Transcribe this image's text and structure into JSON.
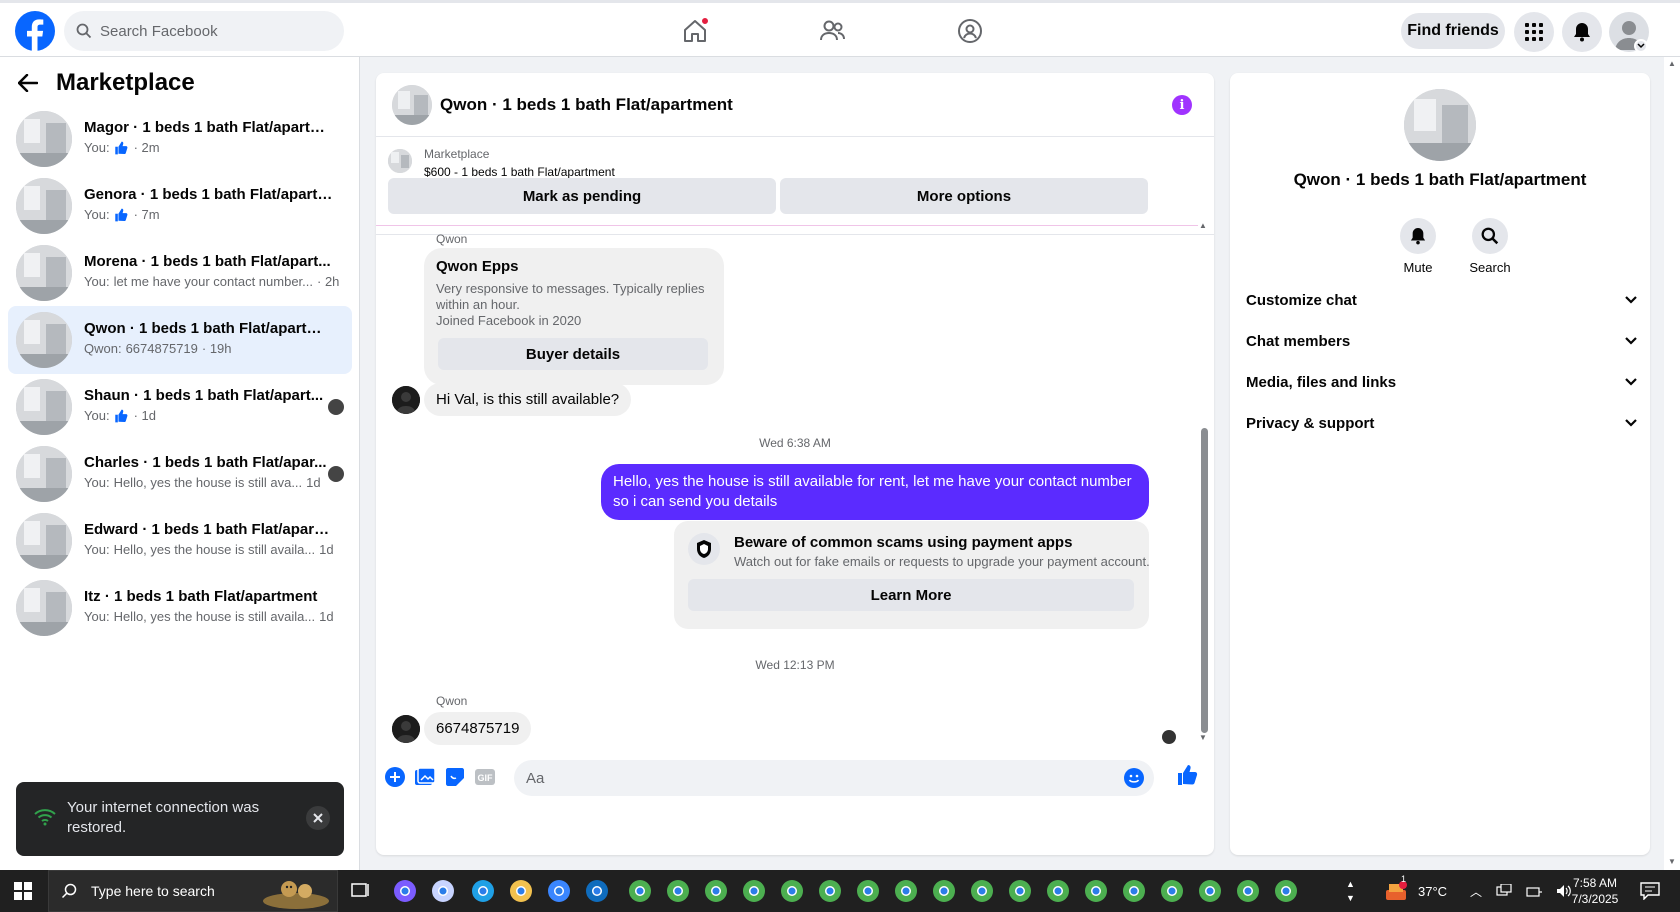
{
  "topbar": {
    "search_placeholder": "Search Facebook",
    "find_friends": "Find friends"
  },
  "sidebar": {
    "title": "Marketplace",
    "conversations": [
      {
        "name": "Magor · 1 beds 1 bath Flat/apartm...",
        "prefix": "You:",
        "snippet": "",
        "time": "· 2m",
        "like": true
      },
      {
        "name": "Genora · 1 beds 1 bath Flat/apartm...",
        "prefix": "You:",
        "snippet": "",
        "time": "· 7m",
        "like": true
      },
      {
        "name": "Morena · 1 beds 1 bath Flat/apart...",
        "prefix": "You:",
        "snippet": "let me have your contact number...",
        "time": "· 2h",
        "like": false
      },
      {
        "name": "Qwon · 1 beds 1 bath Flat/apartment",
        "prefix": "Qwon:",
        "snippet": "6674875719",
        "time": "· 19h",
        "like": false
      },
      {
        "name": "Shaun · 1 beds 1 bath Flat/apart...",
        "prefix": "You:",
        "snippet": "",
        "time": "· 1d",
        "like": true
      },
      {
        "name": "Charles · 1 beds 1 bath Flat/apar...",
        "prefix": "You:",
        "snippet": "Hello, yes the house is still ava...",
        "time": "1d",
        "like": false
      },
      {
        "name": "Edward · 1 beds 1 bath Flat/apartm...",
        "prefix": "You:",
        "snippet": "Hello, yes the house is still availa...",
        "time": "1d",
        "like": false
      },
      {
        "name": "Itz · 1 beds 1 bath Flat/apartment",
        "prefix": "You:",
        "snippet": "Hello, yes the house is still availa...",
        "time": "1d",
        "like": false
      }
    ]
  },
  "toast": {
    "message": "Your internet connection was restored."
  },
  "chat": {
    "title": "Qwon · 1 beds 1 bath Flat/apartment",
    "listing_source": "Marketplace",
    "listing_price": "$600 - 1 beds 1 bath Flat/apartment",
    "mark_pending": "Mark as pending",
    "more_options": "More options",
    "sender_label_1": "Qwon",
    "profile_card": {
      "name": "Qwon Epps",
      "desc_line1": "Very responsive to messages. Typically replies within an hour.",
      "desc_line2": "Joined Facebook in 2020",
      "button": "Buyer details"
    },
    "incoming_1": "Hi Val, is this still available?",
    "timestamp_1": "Wed 6:38 AM",
    "outgoing_1": "Hello, yes the house is still available for rent, let me have your contact number so i can send you details",
    "scam_warning": {
      "title": "Beware of common scams using payment apps",
      "desc": "Watch out for fake emails or requests to upgrade your payment account.",
      "button": "Learn More"
    },
    "timestamp_2": "Wed 12:13 PM",
    "sender_label_2": "Qwon",
    "incoming_2": "6674875719",
    "composer_placeholder": "Aa"
  },
  "details": {
    "title": "Qwon · 1 beds 1 bath Flat/apartment",
    "mute": "Mute",
    "search": "Search",
    "sections": [
      "Customize chat",
      "Chat members",
      "Media, files and links",
      "Privacy & support"
    ]
  },
  "taskbar": {
    "search_placeholder": "Type here to search",
    "temperature": "37°C",
    "time": "7:58 AM",
    "date": "7/3/2025",
    "notification_count": "1"
  },
  "colors": {
    "brand": "#0866ff",
    "outgoing_bubble": "#5b2bff",
    "info_icon": "#a033ff",
    "active_conversation": "#e7f0fd"
  }
}
